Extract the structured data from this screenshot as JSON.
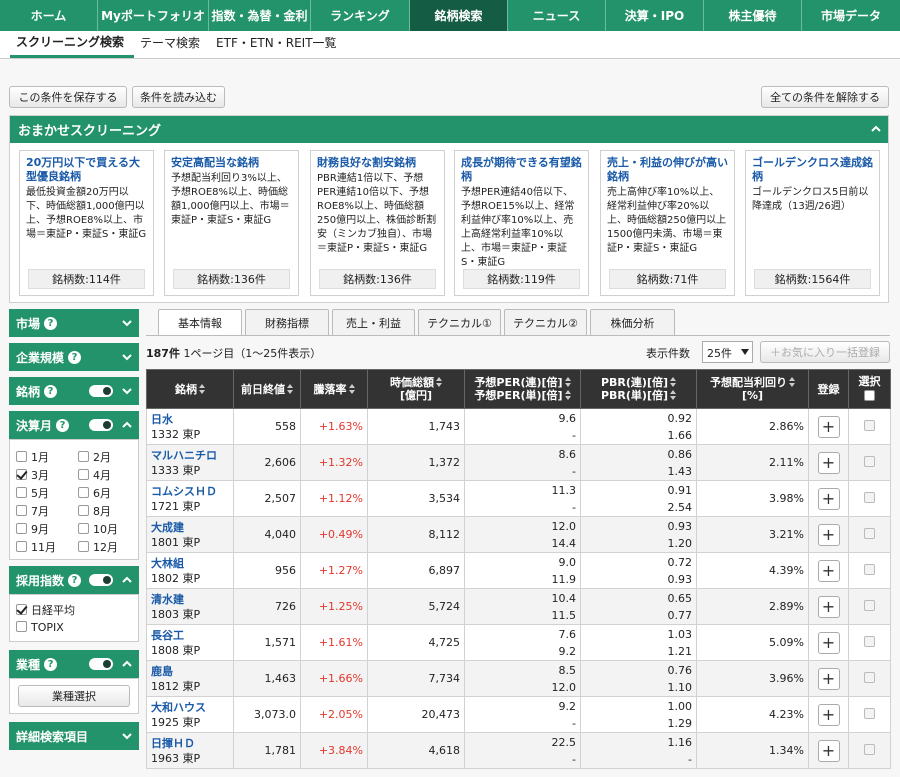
{
  "topnav": [
    "ホーム",
    "Myポートフォリオ",
    "指数・為替・金利",
    "ランキング",
    "銘柄検索",
    "ニュース",
    "決算・IPO",
    "株主優待",
    "市場データ"
  ],
  "subnav": [
    "スクリーニング検索",
    "テーマ検索",
    "ETF・ETN・REIT一覧"
  ],
  "actions": {
    "save": "この条件を保存する",
    "load": "条件を読み込む",
    "clear": "全ての条件を解除する"
  },
  "omakase": {
    "title": "おまかせスクリーニング",
    "cards": [
      {
        "title": "20万円以下で買える大型優良銘柄",
        "desc": "最低投資金額20万円以下、時価総額1,000億円以上、予想ROE8%以上、市場＝東証P・東証S・東証G",
        "count": "銘柄数:114件"
      },
      {
        "title": "安定高配当な銘柄",
        "desc": "予想配当利回り3%以上、予想ROE8%以上、時価総額1,000億円以上、市場＝東証P・東証S・東証G",
        "count": "銘柄数:136件"
      },
      {
        "title": "財務良好な割安銘柄",
        "desc": "PBR連結1倍以下、予想PER連結10倍以下、予想ROE8%以上、時価総額250億円以上、株価診断割安（ミンカブ独自）、市場＝東証P・東証S・東証G",
        "count": "銘柄数:136件"
      },
      {
        "title": "成長が期待できる有望銘柄",
        "desc": "予想PER連結40倍以下、予想ROE15%以上、経常利益伸び率10%以上、売上高経常利益率10%以上、市場＝東証P・東証S・東証G",
        "count": "銘柄数:119件"
      },
      {
        "title": "売上・利益の伸びが高い銘柄",
        "desc": "売上高伸び率10%以上、経常利益伸び率20%以上、時価総額250億円以上1500億円未満、市場＝東証P・東証S・東証G",
        "count": "銘柄数:71件"
      },
      {
        "title": "ゴールデンクロス達成銘柄",
        "desc": "ゴールデンクロス5日前以降達成（13週/26週）",
        "count": "銘柄数:1564件"
      }
    ]
  },
  "sidebar": {
    "market": "市場",
    "size": "企業規模",
    "brand": "銘柄",
    "kessan": "決算月",
    "months": [
      "1月",
      "2月",
      "3月",
      "4月",
      "5月",
      "6月",
      "7月",
      "8月",
      "9月",
      "10月",
      "11月",
      "12月"
    ],
    "index": "採用指数",
    "nikkei": "日経平均",
    "topix": "TOPIX",
    "gyoshu": "業種",
    "gyoshu_btn": "業種選択",
    "detail": "詳細検索項目"
  },
  "tabs": [
    "基本情報",
    "財務指標",
    "売上・利益",
    "テクニカル①",
    "テクニカル②",
    "株価分析"
  ],
  "summary": {
    "count": "187件",
    "page": "1ページ目（1～25件表示）",
    "perpage_label": "表示件数",
    "perpage": "25件",
    "fav": "＋お気に入り一括登録"
  },
  "headers": {
    "name": "銘柄",
    "close": "前日終値",
    "chg": "騰落率",
    "cap1": "時価総額",
    "cap2": "[億円]",
    "per1": "予想PER(連)[倍]",
    "per2": "予想PER(単)[倍]",
    "pbr1": "PBR(連)[倍]",
    "pbr2": "PBR(単)[倍]",
    "div1": "予想配当利回り",
    "div2": "[%]",
    "reg": "登録",
    "sel": "選択"
  },
  "rows": [
    {
      "name": "日水",
      "code": "1332 東P",
      "close": "558",
      "chg": "+1.63%",
      "cap": "1,743",
      "per_c": "9.6",
      "per_s": "-",
      "pbr_c": "0.92",
      "pbr_s": "1.66",
      "div": "2.86%"
    },
    {
      "name": "マルハニチロ",
      "code": "1333 東P",
      "close": "2,606",
      "chg": "+1.32%",
      "cap": "1,372",
      "per_c": "8.6",
      "per_s": "-",
      "pbr_c": "0.86",
      "pbr_s": "1.43",
      "div": "2.11%"
    },
    {
      "name": "コムシスＨＤ",
      "code": "1721 東P",
      "close": "2,507",
      "chg": "+1.12%",
      "cap": "3,534",
      "per_c": "11.3",
      "per_s": "-",
      "pbr_c": "0.91",
      "pbr_s": "2.54",
      "div": "3.98%"
    },
    {
      "name": "大成建",
      "code": "1801 東P",
      "close": "4,040",
      "chg": "+0.49%",
      "cap": "8,112",
      "per_c": "12.0",
      "per_s": "14.4",
      "pbr_c": "0.93",
      "pbr_s": "1.20",
      "div": "3.21%"
    },
    {
      "name": "大林組",
      "code": "1802 東P",
      "close": "956",
      "chg": "+1.27%",
      "cap": "6,897",
      "per_c": "9.0",
      "per_s": "11.9",
      "pbr_c": "0.72",
      "pbr_s": "0.93",
      "div": "4.39%"
    },
    {
      "name": "清水建",
      "code": "1803 東P",
      "close": "726",
      "chg": "+1.25%",
      "cap": "5,724",
      "per_c": "10.4",
      "per_s": "11.5",
      "pbr_c": "0.65",
      "pbr_s": "0.77",
      "div": "2.89%"
    },
    {
      "name": "長谷工",
      "code": "1808 東P",
      "close": "1,571",
      "chg": "+1.61%",
      "cap": "4,725",
      "per_c": "7.6",
      "per_s": "9.2",
      "pbr_c": "1.03",
      "pbr_s": "1.21",
      "div": "5.09%"
    },
    {
      "name": "鹿島",
      "code": "1812 東P",
      "close": "1,463",
      "chg": "+1.66%",
      "cap": "7,734",
      "per_c": "8.5",
      "per_s": "12.0",
      "pbr_c": "0.76",
      "pbr_s": "1.10",
      "div": "3.96%"
    },
    {
      "name": "大和ハウス",
      "code": "1925 東P",
      "close": "3,073.0",
      "chg": "+2.05%",
      "cap": "20,473",
      "per_c": "9.2",
      "per_s": "-",
      "pbr_c": "1.00",
      "pbr_s": "1.29",
      "div": "4.23%"
    },
    {
      "name": "日揮ＨＤ",
      "code": "1963 東P",
      "close": "1,781",
      "chg": "+3.84%",
      "cap": "4,618",
      "per_c": "22.5",
      "per_s": "-",
      "pbr_c": "1.16",
      "pbr_s": "-",
      "div": "1.34%"
    }
  ]
}
